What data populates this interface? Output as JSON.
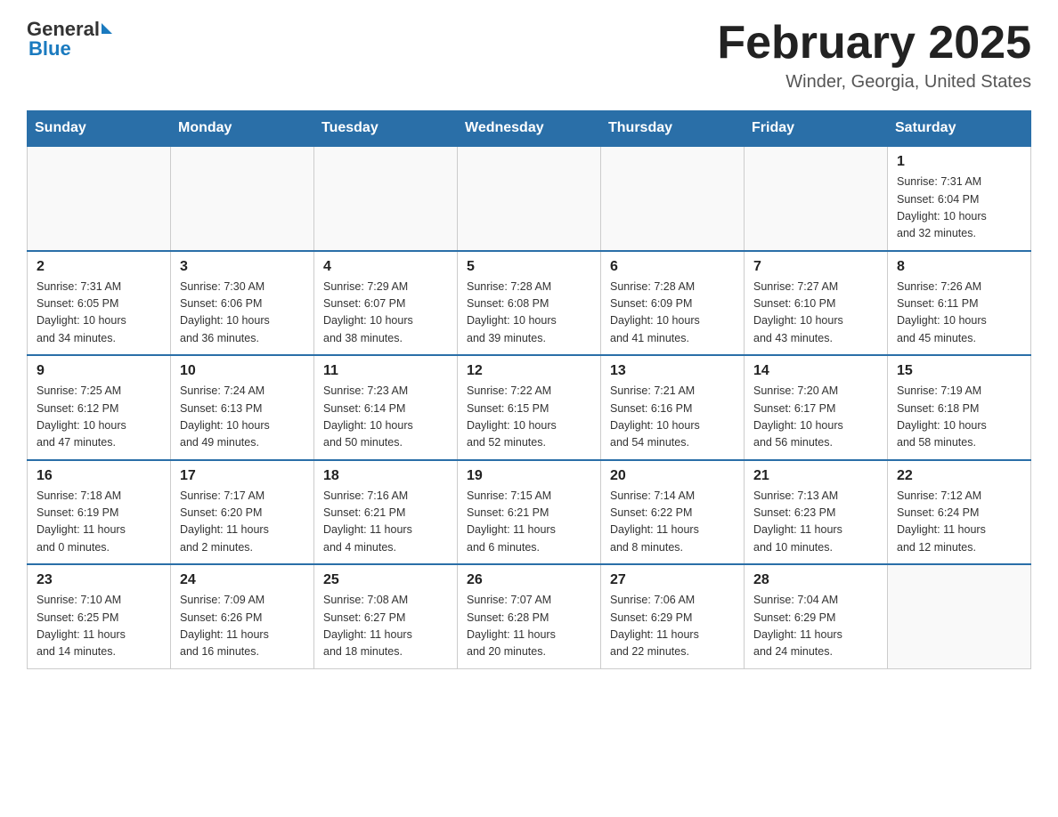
{
  "header": {
    "logo_general": "General",
    "logo_blue": "Blue",
    "month_title": "February 2025",
    "location": "Winder, Georgia, United States"
  },
  "weekdays": [
    "Sunday",
    "Monday",
    "Tuesday",
    "Wednesday",
    "Thursday",
    "Friday",
    "Saturday"
  ],
  "weeks": [
    [
      {
        "day": "",
        "info": ""
      },
      {
        "day": "",
        "info": ""
      },
      {
        "day": "",
        "info": ""
      },
      {
        "day": "",
        "info": ""
      },
      {
        "day": "",
        "info": ""
      },
      {
        "day": "",
        "info": ""
      },
      {
        "day": "1",
        "info": "Sunrise: 7:31 AM\nSunset: 6:04 PM\nDaylight: 10 hours\nand 32 minutes."
      }
    ],
    [
      {
        "day": "2",
        "info": "Sunrise: 7:31 AM\nSunset: 6:05 PM\nDaylight: 10 hours\nand 34 minutes."
      },
      {
        "day": "3",
        "info": "Sunrise: 7:30 AM\nSunset: 6:06 PM\nDaylight: 10 hours\nand 36 minutes."
      },
      {
        "day": "4",
        "info": "Sunrise: 7:29 AM\nSunset: 6:07 PM\nDaylight: 10 hours\nand 38 minutes."
      },
      {
        "day": "5",
        "info": "Sunrise: 7:28 AM\nSunset: 6:08 PM\nDaylight: 10 hours\nand 39 minutes."
      },
      {
        "day": "6",
        "info": "Sunrise: 7:28 AM\nSunset: 6:09 PM\nDaylight: 10 hours\nand 41 minutes."
      },
      {
        "day": "7",
        "info": "Sunrise: 7:27 AM\nSunset: 6:10 PM\nDaylight: 10 hours\nand 43 minutes."
      },
      {
        "day": "8",
        "info": "Sunrise: 7:26 AM\nSunset: 6:11 PM\nDaylight: 10 hours\nand 45 minutes."
      }
    ],
    [
      {
        "day": "9",
        "info": "Sunrise: 7:25 AM\nSunset: 6:12 PM\nDaylight: 10 hours\nand 47 minutes."
      },
      {
        "day": "10",
        "info": "Sunrise: 7:24 AM\nSunset: 6:13 PM\nDaylight: 10 hours\nand 49 minutes."
      },
      {
        "day": "11",
        "info": "Sunrise: 7:23 AM\nSunset: 6:14 PM\nDaylight: 10 hours\nand 50 minutes."
      },
      {
        "day": "12",
        "info": "Sunrise: 7:22 AM\nSunset: 6:15 PM\nDaylight: 10 hours\nand 52 minutes."
      },
      {
        "day": "13",
        "info": "Sunrise: 7:21 AM\nSunset: 6:16 PM\nDaylight: 10 hours\nand 54 minutes."
      },
      {
        "day": "14",
        "info": "Sunrise: 7:20 AM\nSunset: 6:17 PM\nDaylight: 10 hours\nand 56 minutes."
      },
      {
        "day": "15",
        "info": "Sunrise: 7:19 AM\nSunset: 6:18 PM\nDaylight: 10 hours\nand 58 minutes."
      }
    ],
    [
      {
        "day": "16",
        "info": "Sunrise: 7:18 AM\nSunset: 6:19 PM\nDaylight: 11 hours\nand 0 minutes."
      },
      {
        "day": "17",
        "info": "Sunrise: 7:17 AM\nSunset: 6:20 PM\nDaylight: 11 hours\nand 2 minutes."
      },
      {
        "day": "18",
        "info": "Sunrise: 7:16 AM\nSunset: 6:21 PM\nDaylight: 11 hours\nand 4 minutes."
      },
      {
        "day": "19",
        "info": "Sunrise: 7:15 AM\nSunset: 6:21 PM\nDaylight: 11 hours\nand 6 minutes."
      },
      {
        "day": "20",
        "info": "Sunrise: 7:14 AM\nSunset: 6:22 PM\nDaylight: 11 hours\nand 8 minutes."
      },
      {
        "day": "21",
        "info": "Sunrise: 7:13 AM\nSunset: 6:23 PM\nDaylight: 11 hours\nand 10 minutes."
      },
      {
        "day": "22",
        "info": "Sunrise: 7:12 AM\nSunset: 6:24 PM\nDaylight: 11 hours\nand 12 minutes."
      }
    ],
    [
      {
        "day": "23",
        "info": "Sunrise: 7:10 AM\nSunset: 6:25 PM\nDaylight: 11 hours\nand 14 minutes."
      },
      {
        "day": "24",
        "info": "Sunrise: 7:09 AM\nSunset: 6:26 PM\nDaylight: 11 hours\nand 16 minutes."
      },
      {
        "day": "25",
        "info": "Sunrise: 7:08 AM\nSunset: 6:27 PM\nDaylight: 11 hours\nand 18 minutes."
      },
      {
        "day": "26",
        "info": "Sunrise: 7:07 AM\nSunset: 6:28 PM\nDaylight: 11 hours\nand 20 minutes."
      },
      {
        "day": "27",
        "info": "Sunrise: 7:06 AM\nSunset: 6:29 PM\nDaylight: 11 hours\nand 22 minutes."
      },
      {
        "day": "28",
        "info": "Sunrise: 7:04 AM\nSunset: 6:29 PM\nDaylight: 11 hours\nand 24 minutes."
      },
      {
        "day": "",
        "info": ""
      }
    ]
  ]
}
